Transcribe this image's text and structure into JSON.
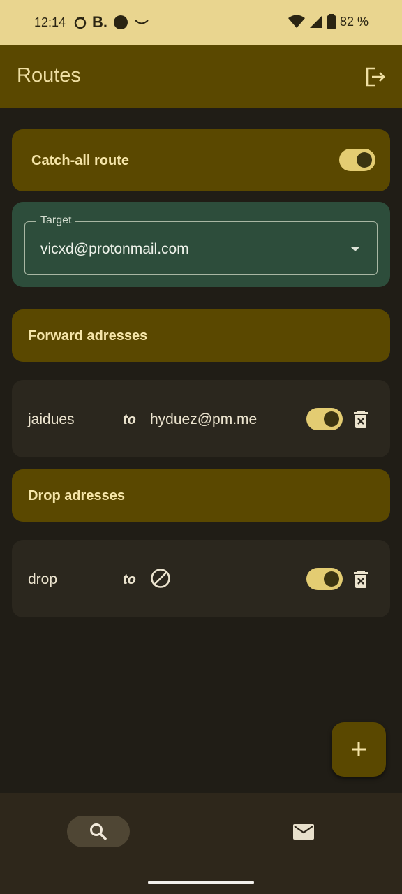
{
  "status_bar": {
    "time": "12:14",
    "left_icons": [
      "cat-face-icon",
      "b-icon",
      "circle-icon",
      "smile-icon"
    ],
    "b_glyph": "B.",
    "right_icons": [
      "wifi-icon",
      "signal-icon",
      "battery-icon"
    ],
    "battery": "82 %"
  },
  "app_bar": {
    "title": "Routes",
    "action_icon": "logout-icon"
  },
  "catch_all": {
    "label": "Catch-all route",
    "enabled": true
  },
  "target": {
    "label": "Target",
    "value": "vicxd@protonmail.com"
  },
  "forward": {
    "header": "Forward adresses",
    "routes": [
      {
        "from": "jaidues",
        "to_label": "to",
        "target": "hyduez@pm.me",
        "enabled": true
      }
    ]
  },
  "drop": {
    "header": "Drop adresses",
    "routes": [
      {
        "from": "drop",
        "to_label": "to",
        "target_icon": "block-icon",
        "enabled": true
      }
    ]
  },
  "fab": {
    "icon": "plus-icon"
  },
  "bottom_nav": {
    "items": [
      {
        "icon": "search-icon",
        "selected": true
      },
      {
        "icon": "mail-icon",
        "selected": false
      }
    ]
  },
  "colors": {
    "accent": "#5a4800",
    "status_bar": "#e9d58f",
    "background": "#201d16",
    "target_card": "#2d4d3b",
    "toggle_track": "#e3cc72"
  }
}
